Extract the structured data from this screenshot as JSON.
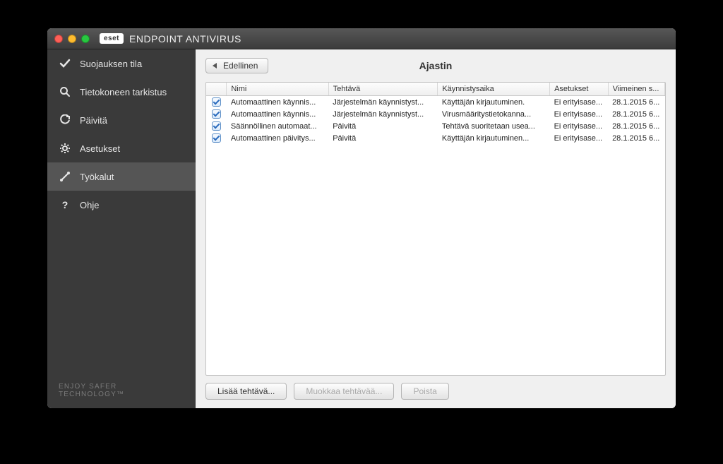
{
  "app": {
    "brand": "eset",
    "title": "ENDPOINT ANTIVIRUS"
  },
  "sidebar": {
    "items": [
      {
        "label": "Suojauksen tila"
      },
      {
        "label": "Tietokoneen tarkistus"
      },
      {
        "label": "Päivitä"
      },
      {
        "label": "Asetukset"
      },
      {
        "label": "Työkalut"
      },
      {
        "label": "Ohje"
      }
    ],
    "footer": "ENJOY SAFER TECHNOLOGY™"
  },
  "main": {
    "back_label": "Edellinen",
    "title": "Ajastin",
    "columns": {
      "check": "",
      "name": "Nimi",
      "task": "Tehtävä",
      "start": "Käynnistysaika",
      "settings": "Asetukset",
      "last": "Viimeinen s..."
    },
    "rows": [
      {
        "checked": true,
        "name": "Automaattinen käynnis...",
        "task": "Järjestelmän käynnistyst...",
        "start": "Käyttäjän kirjautuminen.",
        "settings": "Ei erityisase...",
        "last": "28.1.2015 6..."
      },
      {
        "checked": true,
        "name": "Automaattinen käynnis...",
        "task": "Järjestelmän käynnistyst...",
        "start": "Virusmääritystietokanna...",
        "settings": "Ei erityisase...",
        "last": "28.1.2015 6..."
      },
      {
        "checked": true,
        "name": "Säännöllinen automaat...",
        "task": "Päivitä",
        "start": "Tehtävä suoritetaan usea...",
        "settings": "Ei erityisase...",
        "last": "28.1.2015 6..."
      },
      {
        "checked": true,
        "name": "Automaattinen päivitys...",
        "task": "Päivitä",
        "start": "Käyttäjän kirjautuminen...",
        "settings": "Ei erityisase...",
        "last": "28.1.2015 6..."
      }
    ],
    "buttons": {
      "add": "Lisää tehtävä...",
      "edit": "Muokkaa tehtävää...",
      "delete": "Poista"
    }
  }
}
